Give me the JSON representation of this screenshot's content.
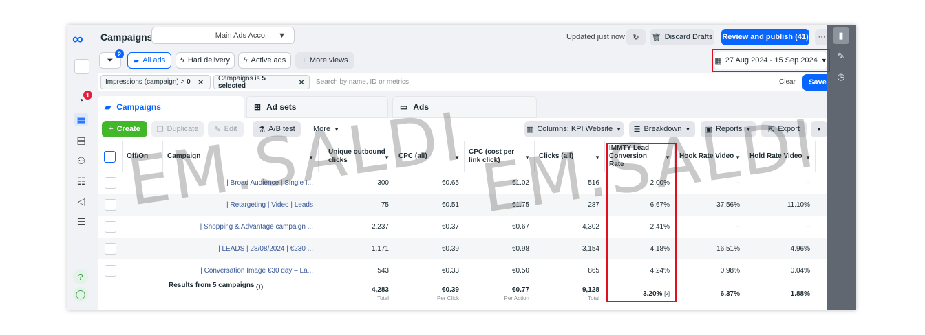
{
  "header": {
    "title": "Campaigns",
    "account": "Main Ads Acco...",
    "updated": "Updated just now",
    "discard": "Discard Drafts",
    "publish": "Review and publish (41)",
    "more": "···"
  },
  "viewbar": {
    "filter_count": "2",
    "all_ads": "All ads",
    "had_delivery": "Had delivery",
    "active_ads": "Active ads",
    "more_views": "More views",
    "date_range": "27 Aug 2024 - 15 Sep 2024"
  },
  "filters": {
    "chip1_label": "Impressions (campaign) > ",
    "chip1_value": "0",
    "chip2_label": "Campaigns is ",
    "chip2_value": "5 selected",
    "search_placeholder": "Search by name, ID or metrics",
    "clear": "Clear",
    "save": "Save"
  },
  "tabs": {
    "campaigns": "Campaigns",
    "adsets": "Ad sets",
    "ads": "Ads"
  },
  "toolbar": {
    "create": "Create",
    "duplicate": "Duplicate",
    "edit": "Edit",
    "abtest": "A/B test",
    "more": "More",
    "columns": "Columns: KPI Website",
    "breakdown": "Breakdown",
    "reports": "Reports",
    "export": "Export"
  },
  "rail": {
    "notifications": "1"
  },
  "columns": {
    "offon": "Off/On",
    "campaign": "Campaign",
    "outbound": "Unique outbound clicks",
    "cpc_all": "CPC (all)",
    "cpc_link": "CPC (cost per link click)",
    "clicks": "Clicks (all)",
    "immty": "IMMTY Lead Conversion Rate",
    "hook": "Hook Rate Video",
    "hold": "Hold Rate Video"
  },
  "rows": [
    {
      "campaign": "| Broad Audience | Single I...",
      "outbound": "300",
      "cpc_all": "€0.65",
      "cpc_link": "€1.02",
      "clicks": "516",
      "immty": "2.00%",
      "hook": "–",
      "hold": "–"
    },
    {
      "campaign": "| Retargeting | Video | Leads",
      "outbound": "75",
      "cpc_all": "€0.51",
      "cpc_link": "€1.75",
      "clicks": "287",
      "immty": "6.67%",
      "hook": "37.56%",
      "hold": "11.10%"
    },
    {
      "campaign": "| Shopping & Advantage campaign ...",
      "outbound": "2,237",
      "cpc_all": "€0.37",
      "cpc_link": "€0.67",
      "clicks": "4,302",
      "immty": "2.41%",
      "hook": "–",
      "hold": "–"
    },
    {
      "campaign": "| LEADS | 28/08/2024 | €230 ...",
      "outbound": "1,171",
      "cpc_all": "€0.39",
      "cpc_link": "€0.98",
      "clicks": "3,154",
      "immty": "4.18%",
      "hook": "16.51%",
      "hold": "4.96%"
    },
    {
      "campaign": "| Conversation Image €30 day – La...",
      "outbound": "543",
      "cpc_all": "€0.33",
      "cpc_link": "€0.50",
      "clicks": "865",
      "immty": "4.24%",
      "hook": "0.98%",
      "hold": "0.04%"
    }
  ],
  "totals": {
    "label": "Results from 5 campaigns",
    "outbound": "4,283",
    "outbound_sub": "Total",
    "cpc_all": "€0.39",
    "cpc_all_sub": "Per Click",
    "cpc_link": "€0.77",
    "cpc_link_sub": "Per Action",
    "clicks": "9,128",
    "clicks_sub": "Total",
    "immty": "3.20%",
    "immty_note": "[2]",
    "hook": "6.37%",
    "hold": "1.88%"
  },
  "watermark": {
    "text1": "EM.SALDI",
    "text2": "EM.SALDI"
  },
  "colors": {
    "accent": "#0866ff",
    "highlight": "#e0101e",
    "create": "#42b72a"
  }
}
